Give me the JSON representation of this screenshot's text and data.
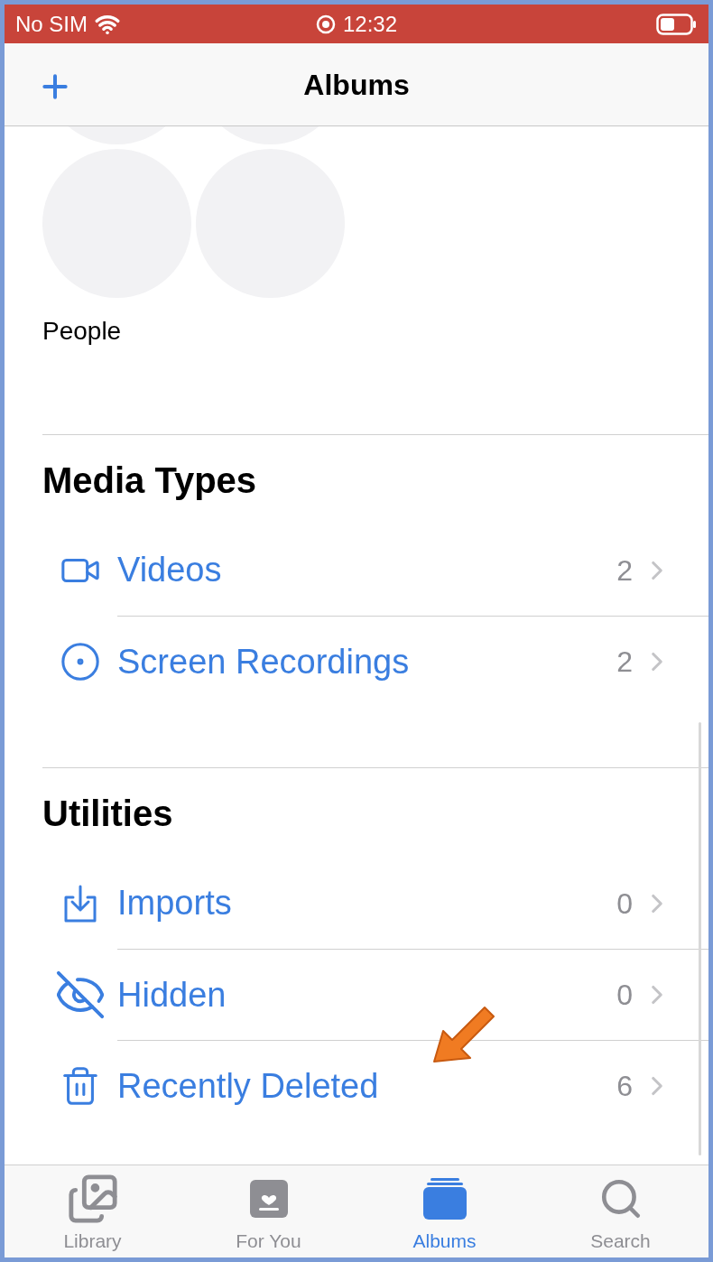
{
  "status_bar": {
    "carrier": "No SIM",
    "time": "12:32"
  },
  "nav": {
    "title": "Albums"
  },
  "people": {
    "label": "People"
  },
  "sections": [
    {
      "title": "Media Types",
      "rows": [
        {
          "kind": "video",
          "label": "Videos",
          "count": "2"
        },
        {
          "kind": "recording",
          "label": "Screen Recordings",
          "count": "2"
        }
      ]
    },
    {
      "title": "Utilities",
      "rows": [
        {
          "kind": "import",
          "label": "Imports",
          "count": "0"
        },
        {
          "kind": "hidden",
          "label": "Hidden",
          "count": "0"
        },
        {
          "kind": "trash",
          "label": "Recently Deleted",
          "count": "6"
        }
      ]
    }
  ],
  "tabs": [
    {
      "kind": "library",
      "label": "Library",
      "selected": false
    },
    {
      "kind": "foryou",
      "label": "For You",
      "selected": false
    },
    {
      "kind": "albums",
      "label": "Albums",
      "selected": true
    },
    {
      "kind": "search",
      "label": "Search",
      "selected": false
    }
  ]
}
